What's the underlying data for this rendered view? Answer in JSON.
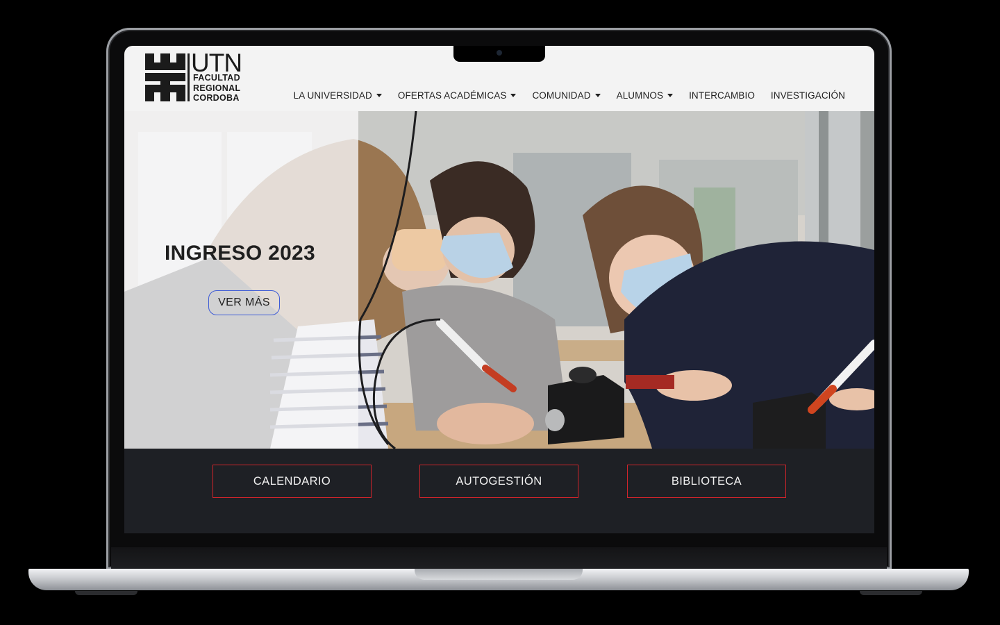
{
  "logo": {
    "abbr": "UTN",
    "line1": "FACULTAD",
    "line2": "REGIONAL",
    "line3": "CORDOBA"
  },
  "nav": {
    "items": [
      {
        "label": "LA UNIVERSIDAD",
        "dropdown": true
      },
      {
        "label": "OFERTAS ACADÉMICAS",
        "dropdown": true
      },
      {
        "label": "COMUNIDAD",
        "dropdown": true
      },
      {
        "label": "ALUMNOS",
        "dropdown": true
      },
      {
        "label": "INTERCAMBIO",
        "dropdown": false
      },
      {
        "label": "INVESTIGACIÓN",
        "dropdown": false
      }
    ]
  },
  "hero": {
    "title": "INGRESO 2023",
    "button_label": "VER MÁS",
    "image_description_icon": "students-soldering-photo"
  },
  "quick_links": {
    "calendar": "CALENDARIO",
    "self_service": "AUTOGESTIÓN",
    "library": "BIBLIOTECA",
    "border_color": "#d1242b"
  },
  "colors": {
    "header_bg": "#f3f3f3",
    "dark_bg": "#1e2025",
    "accent_blue": "#3d5bd6",
    "accent_red": "#d1242b"
  }
}
